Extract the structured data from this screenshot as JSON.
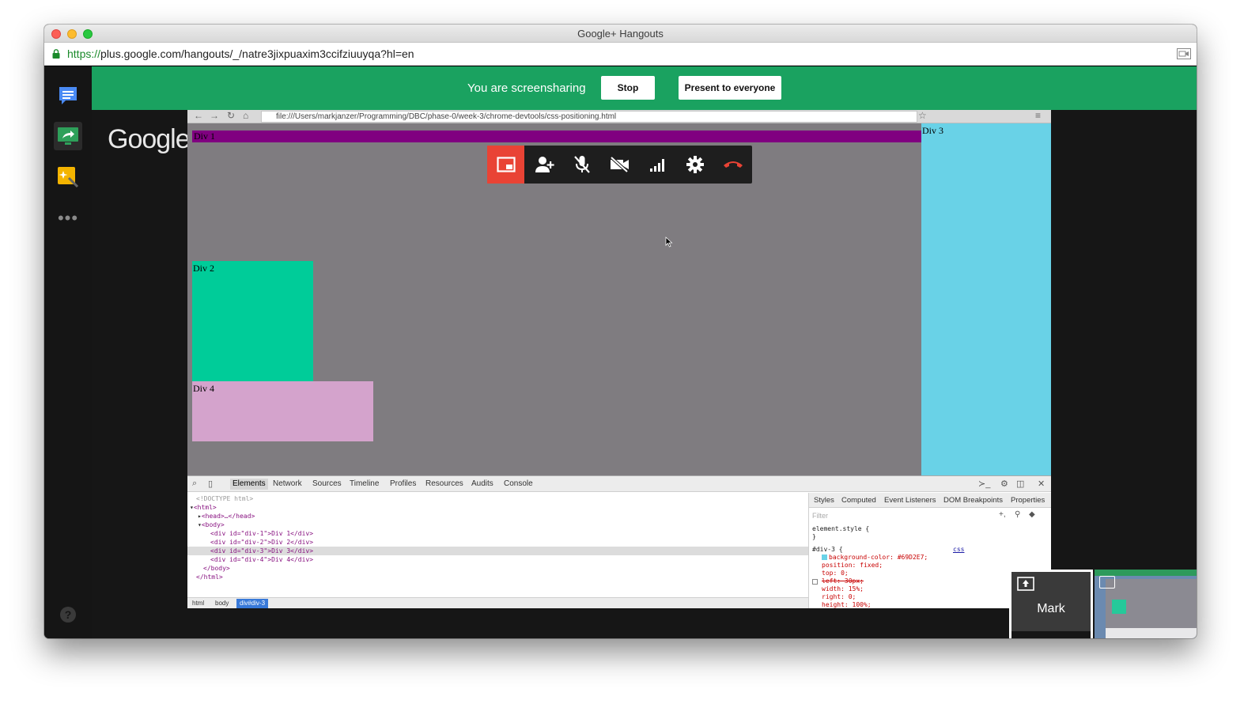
{
  "window": {
    "title": "Google+ Hangouts"
  },
  "urlbar": {
    "scheme": "https://",
    "url": "plus.google.com/hangouts/_/natre3jixpuaxim3ccifziuuyqa?hl=en"
  },
  "stage": {
    "logo": "Google"
  },
  "banner": {
    "status": "You are screensharing",
    "stop_label": "Stop",
    "present_label": "Present to everyone",
    "color": "#1aa260"
  },
  "shared_screen": {
    "url": "file:///Users/markjanzer/Programming/DBC/phase-0/week-3/chrome-devtools/css-positioning.html",
    "divs": {
      "div1": "Div 1",
      "div2": "Div 2",
      "div3": "Div 3",
      "div4": "Div 4"
    },
    "devtools": {
      "tabs": [
        "Elements",
        "Network",
        "Sources",
        "Timeline",
        "Profiles",
        "Resources",
        "Audits",
        "Console"
      ],
      "dom": [
        "<!DOCTYPE html>",
        "<html>",
        "<head>…</head>",
        "<body>",
        "<div id=\"div-1\">Div 1</div>",
        "<div id=\"div-2\">Div 2</div>",
        "<div id=\"div-3\">Div 3</div>",
        "<div id=\"div-4\">Div 4</div>",
        "</body>",
        "</html>"
      ],
      "breadcrumbs": [
        "html",
        "body",
        "div#div-3"
      ],
      "style_tabs": [
        "Styles",
        "Computed",
        "Event Listeners",
        "DOM Breakpoints",
        "Properties"
      ],
      "filter_placeholder": "Filter",
      "element_style": "element.style {",
      "element_style_close": "}",
      "rule_selector": "#div-3 {",
      "rule_source": "css",
      "rule_props": [
        "background-color: #69D2E7;",
        "position: fixed;",
        "top: 0;",
        "left: 30px;",
        "width: 15%;",
        "right: 0;",
        "height: 100%;"
      ]
    }
  },
  "participants": {
    "self_name": "Mark"
  }
}
